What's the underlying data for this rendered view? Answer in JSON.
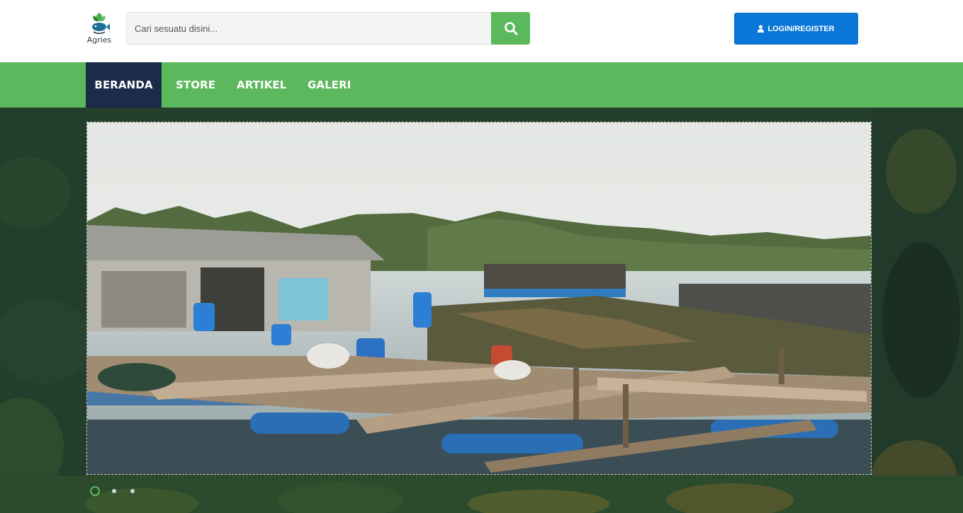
{
  "brand": {
    "name": "Agries",
    "logo_icon": "fish-leaf-logo-icon"
  },
  "search": {
    "placeholder": "Cari sesuatu disini...",
    "value": "",
    "button_icon": "search-icon"
  },
  "auth": {
    "label": "LOGIN/REGISTER",
    "icon": "user-icon"
  },
  "nav": {
    "items": [
      {
        "label": "BERANDA",
        "active": true
      },
      {
        "label": "STORE",
        "active": false
      },
      {
        "label": "ARTIKEL",
        "active": false
      },
      {
        "label": "GALERI",
        "active": false
      }
    ]
  },
  "carousel": {
    "slide_count": 3,
    "active_index": 0,
    "slide_image": "floating fish farm rafts on water"
  },
  "colors": {
    "nav_green": "#5cb85c",
    "nav_active": "#1c2b4a",
    "login_blue": "#0b77d8",
    "hero_dark_green": "#22402a"
  }
}
